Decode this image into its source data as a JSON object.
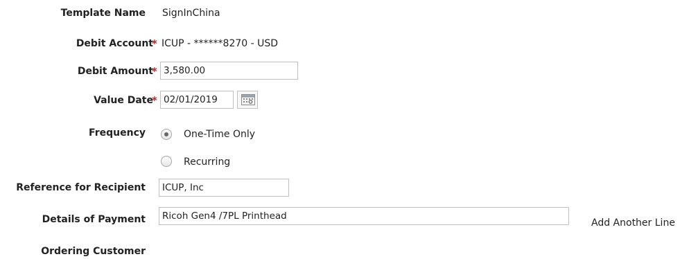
{
  "form": {
    "template_name": {
      "label": "Template Name",
      "value": "SignInChina"
    },
    "debit_account": {
      "label": "Debit Account",
      "required_mark": "*",
      "value": "ICUP - ******8270 - USD"
    },
    "debit_amount": {
      "label": "Debit Amount",
      "required_mark": "*",
      "value": "3,580.00"
    },
    "value_date": {
      "label": "Value Date",
      "required_mark": "*",
      "value": "02/01/2019",
      "calendar_icon": "calendar-icon"
    },
    "frequency": {
      "label": "Frequency",
      "options": [
        {
          "label": "One-Time Only",
          "checked": true
        },
        {
          "label": "Recurring",
          "checked": false
        }
      ]
    },
    "reference_for_recipient": {
      "label": "Reference for Recipient",
      "value": "ICUP, Inc"
    },
    "details_of_payment": {
      "label": "Details of Payment",
      "value": "Ricoh Gen4 /7PL Printhead",
      "add_line_label": "Add Another Line"
    },
    "ordering_customer": {
      "label": "Ordering Customer"
    }
  },
  "colors": {
    "required": "#cc1f1f",
    "border": "#bfbfbf",
    "text": "#222222"
  }
}
